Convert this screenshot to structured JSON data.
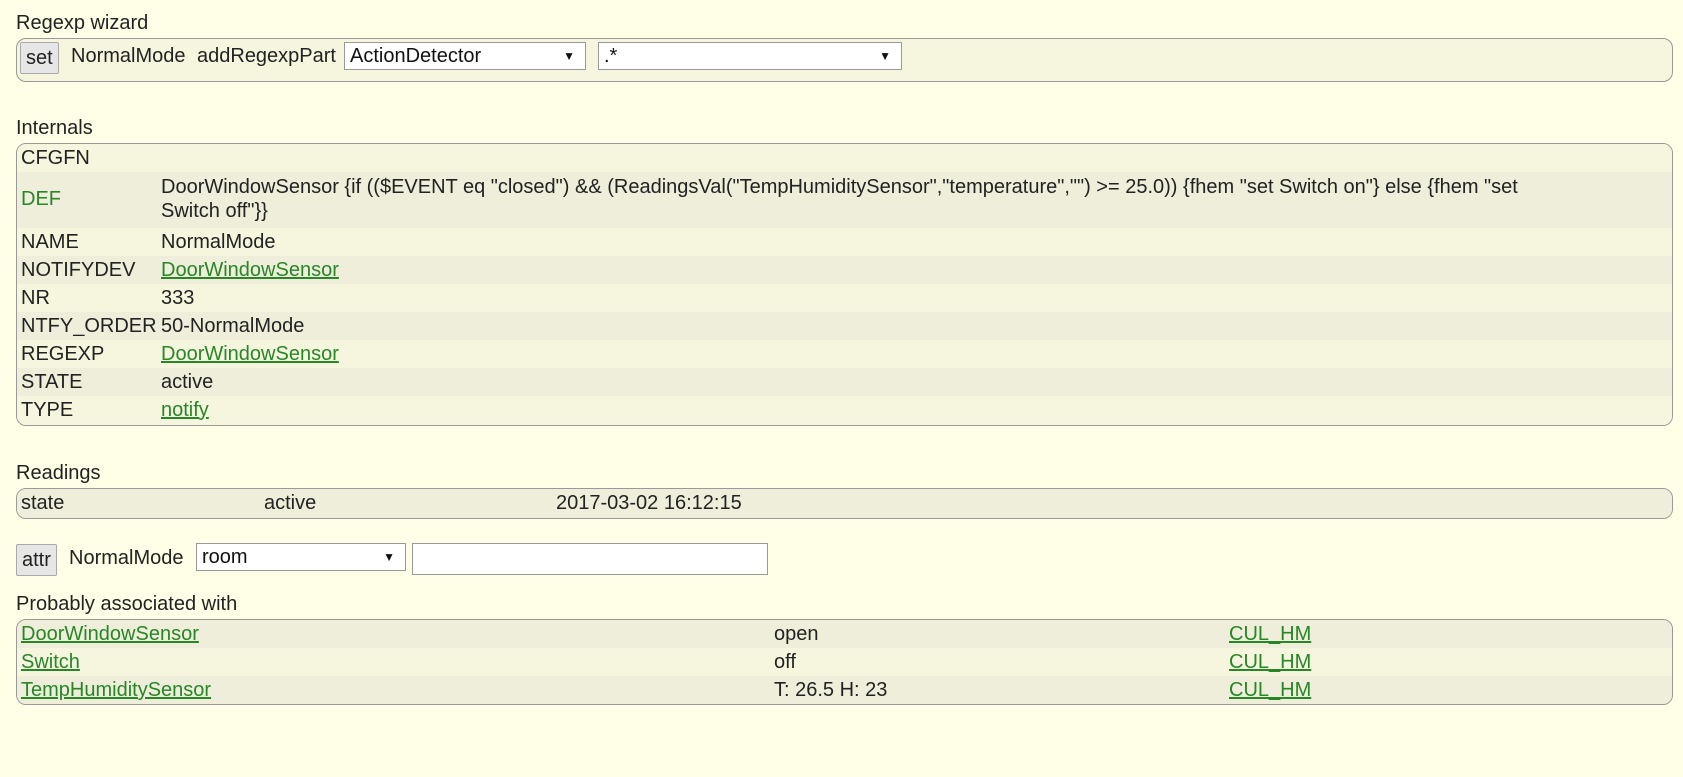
{
  "regexp_wizard": {
    "title": "Regexp wizard",
    "set_button": "set",
    "device_name": "NormalMode",
    "command": "addRegexpPart",
    "select1": "ActionDetector",
    "select2": ".*"
  },
  "internals": {
    "title": "Internals",
    "rows": [
      {
        "key": "CFGFN",
        "value": ""
      },
      {
        "key": "DEF",
        "value": "DoorWindowSensor {if (($EVENT eq \"closed\") && (ReadingsVal(\"TempHumiditySensor\",\"temperature\",\"\") >= 25.0)) {fhem \"set Switch on\"} else {fhem \"set Switch off\"}}"
      },
      {
        "key": "NAME",
        "value": "NormalMode"
      },
      {
        "key": "NOTIFYDEV",
        "value": "DoorWindowSensor"
      },
      {
        "key": "NR",
        "value": "333"
      },
      {
        "key": "NTFY_ORDER",
        "value": "50-NormalMode"
      },
      {
        "key": "REGEXP",
        "value": "DoorWindowSensor"
      },
      {
        "key": "STATE",
        "value": "active"
      },
      {
        "key": "TYPE",
        "value": "notify"
      }
    ]
  },
  "readings": {
    "title": "Readings",
    "rows": [
      {
        "name": "state",
        "value": "active",
        "time": "2017-03-02 16:12:15"
      }
    ]
  },
  "attr": {
    "button": "attr",
    "device_name": "NormalMode",
    "select": "room",
    "input_value": ""
  },
  "associated": {
    "title": "Probably associated with",
    "rows": [
      {
        "name": "DoorWindowSensor",
        "state": "open",
        "type": "CUL_HM"
      },
      {
        "name": "Switch",
        "state": "off",
        "type": "CUL_HM"
      },
      {
        "name": "TempHumiditySensor",
        "state": "T: 26.5 H: 23",
        "type": "CUL_HM"
      }
    ]
  },
  "colors": {
    "background": "#ffffe7",
    "link": "#278727",
    "row_odd": "#f6f6df",
    "row_even": "#eeeeda"
  }
}
